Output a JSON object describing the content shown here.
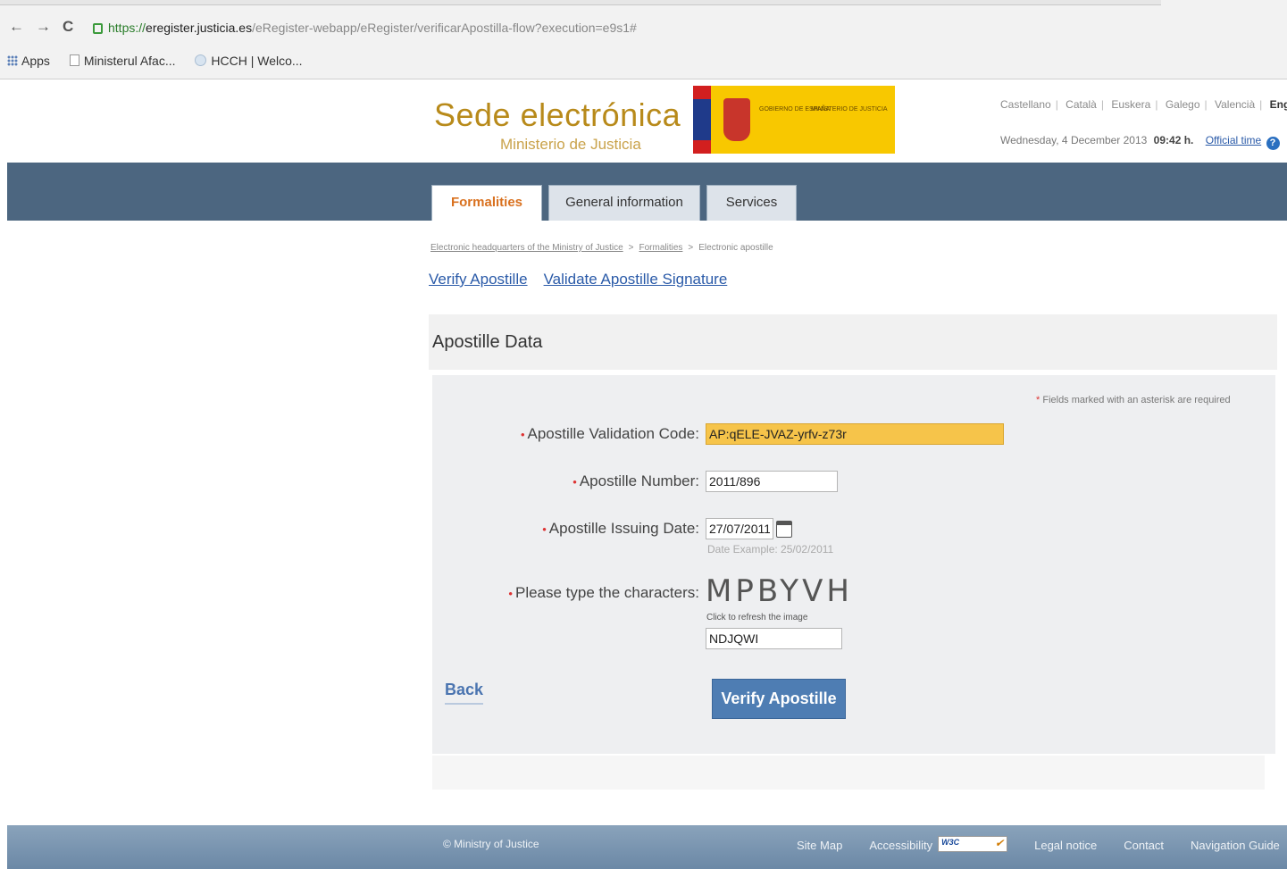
{
  "browser": {
    "url_https": "https://",
    "url_host": "eregister.justicia.es",
    "url_path": "/eRegister-webapp/eRegister/verificarApostilla-flow?execution=e9s1#",
    "bookmarks": [
      "Apps",
      "Ministerul Afac...",
      "HCCH | Welco..."
    ]
  },
  "header": {
    "title": "Sede electrónica",
    "subtitle": "Ministerio de Justicia",
    "logo_text_1": "GOBIERNO DE ESPAÑA",
    "logo_text_2": "MINISTERIO DE JUSTICIA",
    "languages": [
      "Castellano",
      "Català",
      "Euskera",
      "Galego",
      "Valencià",
      "English"
    ],
    "active_language": "English",
    "date": "Wednesday, 4 December 2013",
    "time": "09:42 h.",
    "official_time_link": "Official time"
  },
  "tabs": [
    {
      "label": "Formalities",
      "active": true
    },
    {
      "label": "General information",
      "active": false
    },
    {
      "label": "Services",
      "active": false
    }
  ],
  "breadcrumb": [
    "Electronic headquarters of the Ministry of Justice",
    "Formalities",
    "Electronic apostille"
  ],
  "subnav": [
    "Verify Apostille",
    "Validate Apostille Signature"
  ],
  "panel": {
    "title": "Apostille Data",
    "required_note": "Fields marked with an asterisk are required",
    "fields": {
      "validation_code": {
        "label": "Apostille Validation Code:",
        "value": "AP:qELE-JVAZ-yrfv-z73r"
      },
      "number": {
        "label": "Apostille Number:",
        "value": "2011/896"
      },
      "issuing_date": {
        "label": "Apostille Issuing Date:",
        "value": "27/07/2011",
        "hint": "Date Example: 25/02/2011"
      },
      "captcha": {
        "label": "Please type the characters:",
        "image_text": "MPBYVH",
        "refresh": "Click to refresh the image",
        "value": "NDJQWI"
      }
    },
    "back_label": "Back",
    "submit_label": "Verify Apostille"
  },
  "footer": {
    "copyright": "© Ministry of Justice",
    "links": [
      "Site Map",
      "Accessibility",
      "Legal notice",
      "Contact",
      "Navigation Guide"
    ]
  },
  "colors": {
    "accent": "#d9711f",
    "nav_band": "#4c6680",
    "highlight_input": "#f6c44a",
    "button": "#4e7db3"
  }
}
